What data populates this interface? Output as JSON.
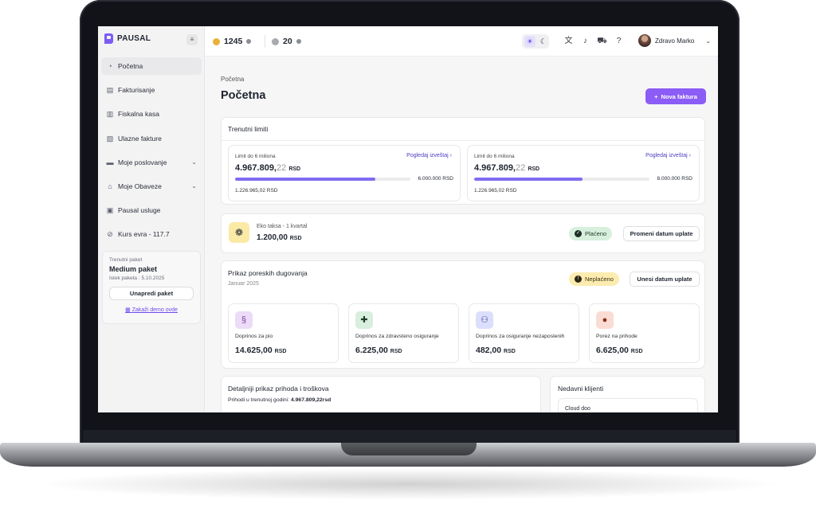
{
  "sidebar": {
    "logo_text": "PAUSAL",
    "items": [
      {
        "label": "Početna",
        "icon": "pie-chart-icon"
      },
      {
        "label": "Fakturisanje",
        "icon": "document-icon"
      },
      {
        "label": "Fiskalna kasa",
        "icon": "cash-register-icon"
      },
      {
        "label": "Ulazne fakture",
        "icon": "incoming-document-icon"
      },
      {
        "label": "Moje poslovanje",
        "icon": "laptop-icon"
      },
      {
        "label": "Moje Obaveze",
        "icon": "bank-icon"
      },
      {
        "label": "Pausal usluge",
        "icon": "briefcase-icon"
      },
      {
        "label": "Kurs evra - 117.7",
        "icon": "exchange-icon"
      }
    ],
    "package": {
      "label": "Trenutni paket",
      "name": "Medium paket",
      "expiry": "Istek paketa : 5.10.2025",
      "upgrade_label": "Unapredi paket",
      "demo_label": "Zakaži demo ovde"
    }
  },
  "topbar": {
    "coins_gold": "1245",
    "coins_silver": "20",
    "user_name": "Zdravo Marko",
    "colors": {
      "gold": "#e8b23a",
      "silver": "#a9abb0",
      "accent": "#8b5cf6"
    }
  },
  "main": {
    "breadcrumb": "Početna",
    "title": "Početna",
    "new_invoice_label": "Nova faktura",
    "limits": {
      "title": "Trenutni limiti",
      "cards": [
        {
          "label": "Limit do 6 miliona",
          "link": "Pogledaj izveštaj",
          "amount_int": "4.967.809,",
          "amount_dec": "22",
          "currency": "RSD",
          "max": "6.000.000 RSD",
          "used": "1.226.965,02 RSD",
          "progress": 0.8
        },
        {
          "label": "Limit do 6 miliona",
          "link": "Pogledaj izveštaj",
          "amount_int": "4.967.809,",
          "amount_dec": "22",
          "currency": "RSD",
          "max": "8.000.000 RSD",
          "used": "1.226.965,02 RSD",
          "progress": 0.62
        }
      ]
    },
    "eko": {
      "label": "Eko taksa - 1 kvartal",
      "amount": "1.200,00",
      "currency": "RSD",
      "status": "Plaćeno",
      "button": "Promeni datum uplate"
    },
    "porez": {
      "title": "Prikaz poreskih dugovanja",
      "subtitle": "Januar 2025",
      "status": "Neplaćeno",
      "button": "Unesi datum uplate",
      "items": [
        {
          "label": "Doprinos za pio",
          "amount": "14.625,00",
          "currency": "RSD",
          "icon": "pio-icon",
          "color": "#ecdcf7"
        },
        {
          "label": "Doprinos za zdravsteno osiguranje",
          "amount": "6.225,00",
          "currency": "RSD",
          "icon": "health-cross-icon",
          "color": "#d8eede"
        },
        {
          "label": "Doprinos za osiguranje nezaposlenih",
          "amount": "482,00",
          "currency": "RSD",
          "icon": "people-icon",
          "color": "#dcdffb"
        },
        {
          "label": "Porez na prihode",
          "amount": "6.625,00",
          "currency": "RSD",
          "icon": "tax-coin-icon",
          "color": "#fbdcd4"
        }
      ]
    },
    "detail": {
      "title": "Detaljniji prikaz prihoda i troškova",
      "income_label": "Prihodi u trenutnoj godini:",
      "income_value": "4.967.809,22rsd"
    },
    "clients": {
      "title": "Nedavni klijenti",
      "first": "Cloud doo"
    }
  }
}
